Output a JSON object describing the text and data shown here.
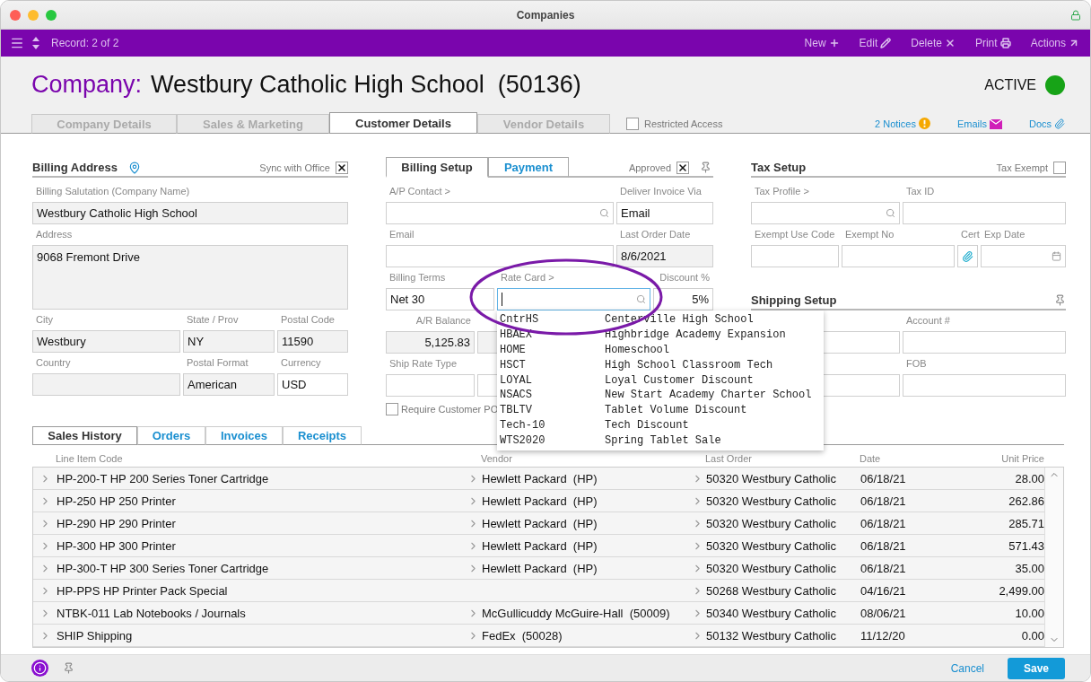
{
  "window": {
    "title": "Companies"
  },
  "toolbar": {
    "record": "Record: 2 of 2",
    "actions": [
      {
        "label": "New"
      },
      {
        "label": "Edit"
      },
      {
        "label": "Delete"
      },
      {
        "label": "Print"
      },
      {
        "label": "Actions"
      }
    ]
  },
  "header": {
    "label": "Company:",
    "name": "Westbury Catholic High School  (50136)",
    "status": "ACTIVE",
    "active": true
  },
  "tabs": [
    {
      "label": "Company Details",
      "selected": false
    },
    {
      "label": "Sales & Marketing",
      "selected": false
    },
    {
      "label": "Customer Details",
      "selected": true
    },
    {
      "label": "Vendor Details",
      "selected": false
    }
  ],
  "restricted_access": {
    "label": "Restricted Access",
    "checked": false
  },
  "links": [
    {
      "label": "2 Notices"
    },
    {
      "label": "Emails"
    },
    {
      "label": "Docs"
    }
  ],
  "billing_address": {
    "title": "Billing Address",
    "sync": {
      "label": "Sync with Office",
      "checked": true
    },
    "rows": [
      [
        {
          "label": "Billing Salutation (Company Name)",
          "value": "Westbury Catholic High School",
          "readonly": true
        }
      ],
      [
        {
          "label": "Address",
          "value": "9068 Fremont Drive",
          "kind": "textarea",
          "readonly": true
        }
      ],
      [
        {
          "label": "City",
          "value": "Westbury",
          "readonly": true
        },
        {
          "label": "State / Prov",
          "value": "NY",
          "readonly": true
        },
        {
          "label": "Postal Code",
          "value": "11590",
          "readonly": true
        }
      ],
      [
        {
          "label": "Country",
          "readonly": true
        },
        {
          "label": "Postal Format",
          "value": "American",
          "readonly": true
        },
        {
          "label": "Currency",
          "value": "USD",
          "readonly": false
        }
      ]
    ]
  },
  "billing_setup": {
    "tabs": [
      {
        "label": "Billing Setup",
        "selected": true
      },
      {
        "label": "Payment",
        "selected": false
      }
    ],
    "approved": {
      "label": "Approved",
      "checked": true
    },
    "rows": [
      [
        {
          "label": "A/P Contact >",
          "kind": "search",
          "readonly": false
        },
        {
          "label": "Deliver Invoice Via",
          "value": "Email",
          "readonly": false
        }
      ],
      [
        {
          "label": "Email",
          "readonly": false
        },
        {
          "label": "Last Order Date",
          "value": "8/6/2021",
          "readonly": true
        }
      ],
      [
        {
          "label": "Billing Terms",
          "value": "Net 30",
          "readonly": false
        },
        {
          "label": "Rate Card >",
          "kind": "search",
          "readonly": false,
          "focused": true
        },
        {
          "label": "Discount %",
          "value": "5%",
          "readonly": false
        }
      ],
      [
        {
          "label": "A/R Balance",
          "value": "5,125.83",
          "readonly": true
        },
        {
          "readonly": true
        }
      ],
      [
        {
          "label": "Ship Rate Type",
          "readonly": false
        },
        {
          "readonly": false
        }
      ]
    ],
    "require_po": {
      "label": "Require Customer PO",
      "checked": false
    },
    "rate_card_options": [
      {
        "code": "CntrHS",
        "name": "Centerville High School"
      },
      {
        "code": "HBAEX",
        "name": "Highbridge Academy Expansion"
      },
      {
        "code": "HOME",
        "name": "Homeschool"
      },
      {
        "code": "HSCT",
        "name": "High School Classroom Tech"
      },
      {
        "code": "LOYAL",
        "name": "Loyal Customer Discount"
      },
      {
        "code": "NSACS",
        "name": "New Start Academy Charter School"
      },
      {
        "code": "TBLTV",
        "name": "Tablet Volume Discount"
      },
      {
        "code": "Tech-10",
        "name": "Tech Discount"
      },
      {
        "code": "WTS2020",
        "name": "Spring Tablet Sale"
      }
    ]
  },
  "tax_setup": {
    "title": "Tax Setup",
    "exempt": {
      "label": "Tax Exempt",
      "checked": false
    },
    "rows": [
      [
        {
          "label": "Tax Profile >",
          "kind": "search",
          "readonly": false
        },
        {
          "label": "Tax ID",
          "readonly": false
        }
      ],
      [
        {
          "label": "Exempt Use Code",
          "readonly": false
        },
        {
          "label": "Exempt No",
          "readonly": false
        },
        {
          "label": "Cert",
          "kind": "attach",
          "readonly": false
        },
        {
          "label": "Exp Date",
          "kind": "date",
          "readonly": false
        }
      ]
    ]
  },
  "shipping_setup": {
    "title": "Shipping Setup",
    "rows": [
      [
        {
          "readonly": false
        },
        {
          "label": "Account #",
          "readonly": false
        }
      ],
      [
        {
          "readonly": false
        },
        {
          "label": "FOB",
          "readonly": false
        }
      ]
    ]
  },
  "history_tabs": [
    {
      "label": "Sales History",
      "selected": true
    },
    {
      "label": "Orders",
      "selected": false
    },
    {
      "label": "Invoices",
      "selected": false
    },
    {
      "label": "Receipts",
      "selected": false
    }
  ],
  "table": {
    "columns": [
      "Line Item Code",
      "Vendor",
      "Last Order",
      "Date",
      "Unit Price"
    ],
    "rows": [
      {
        "item": "HP-200-T HP 200 Series Toner Cartridge",
        "vendor": "Hewlett Packard  (HP)",
        "order": "50320 Westbury Catholic",
        "date": "06/18/21",
        "price": "28.00"
      },
      {
        "item": "HP-250 HP 250 Printer",
        "vendor": "Hewlett Packard  (HP)",
        "order": "50320 Westbury Catholic",
        "date": "06/18/21",
        "price": "262.86"
      },
      {
        "item": "HP-290 HP 290 Printer",
        "vendor": "Hewlett Packard  (HP)",
        "order": "50320 Westbury Catholic",
        "date": "06/18/21",
        "price": "285.71"
      },
      {
        "item": "HP-300 HP 300 Printer",
        "vendor": "Hewlett Packard  (HP)",
        "order": "50320 Westbury Catholic",
        "date": "06/18/21",
        "price": "571.43"
      },
      {
        "item": "HP-300-T HP 300 Series Toner Cartridge",
        "vendor": "Hewlett Packard  (HP)",
        "order": "50320 Westbury Catholic",
        "date": "06/18/21",
        "price": "35.00"
      },
      {
        "item": "HP-PPS HP Printer Pack Special",
        "order": "50268 Westbury Catholic",
        "date": "04/16/21",
        "price": "2,499.00"
      },
      {
        "item": "NTBK-011 Lab Notebooks / Journals",
        "vendor": "McGullicuddy McGuire-Hall  (50009)",
        "order": "50340 Westbury Catholic",
        "date": "08/06/21",
        "price": "10.00"
      },
      {
        "item": "SHIP Shipping",
        "vendor": "FedEx  (50028)",
        "order": "50132 Westbury Catholic",
        "date": "11/12/20",
        "price": "0.00"
      }
    ]
  },
  "footer": {
    "cancel": "Cancel",
    "save": "Save"
  }
}
